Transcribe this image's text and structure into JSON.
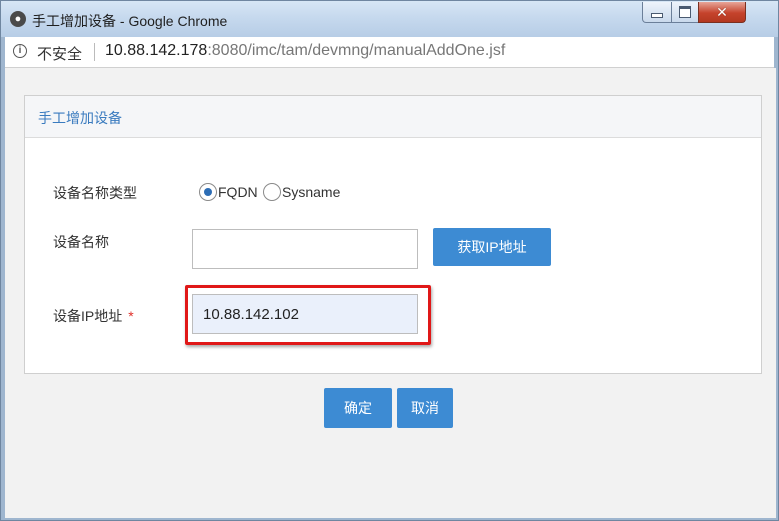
{
  "window": {
    "title": "手工增加设备 - Google Chrome",
    "icon": "chrome-icon"
  },
  "address_bar": {
    "security_label": "不安全",
    "url_host": "10.88.142.178",
    "url_rest": ":8080/imc/tam/devmng/manualAddOne.jsf"
  },
  "panel": {
    "title": "手工增加设备"
  },
  "form": {
    "name_type_label": "设备名称类型",
    "name_type_options": [
      "FQDN",
      "Sysname"
    ],
    "name_type_selected": "FQDN",
    "device_name_label": "设备名称",
    "device_name_value": "",
    "get_ip_button": "获取IP地址",
    "device_ip_label": "设备IP地址",
    "required_mark": "*",
    "device_ip_value": "10.88.142.102"
  },
  "actions": {
    "confirm": "确定",
    "cancel": "取消"
  },
  "colors": {
    "accent": "#3d8bd3",
    "panel_title": "#3a7bbf",
    "highlight_box": "#e01818",
    "required": "#e0302a"
  }
}
